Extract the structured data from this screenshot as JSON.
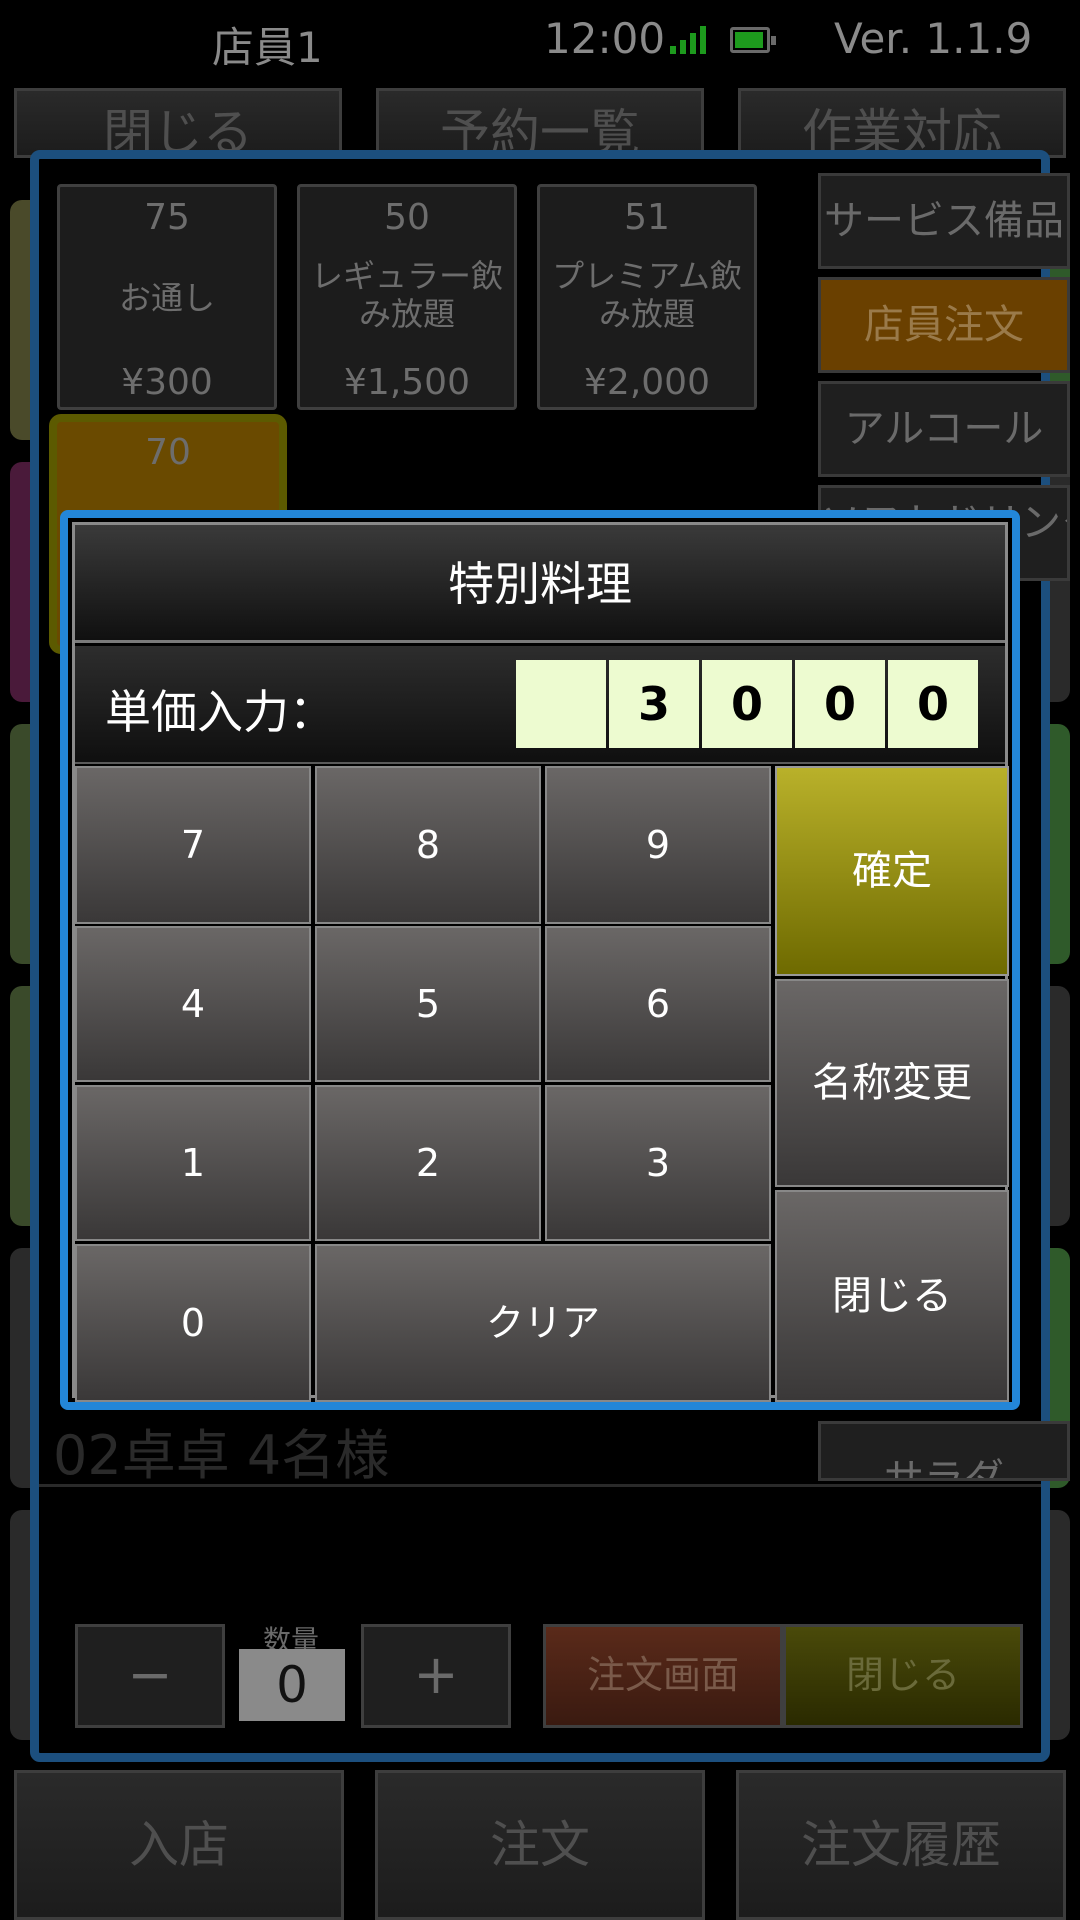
{
  "status_bar": {
    "user": "店員1",
    "time": "12:00",
    "version": "Ver. 1.1.9",
    "icons": [
      "signal-icon",
      "battery-icon"
    ],
    "colors": {
      "signal": "#1d9a1d",
      "battery": "#1d9a1d"
    }
  },
  "top_tabs": [
    "閉じる",
    "予約一覧",
    "作業対応"
  ],
  "background": {
    "table_label": "02卓卓 4名様"
  },
  "bottom_nav": [
    "入店",
    "注文",
    "注文履歴"
  ],
  "menu": {
    "items": [
      {
        "number": "75",
        "name": "お通し",
        "price": "¥300"
      },
      {
        "number": "50",
        "name": "レギュラー飲み放題",
        "price": "¥1,500"
      },
      {
        "number": "51",
        "name": "プレミアム飲み放題",
        "price": "¥2,000"
      },
      {
        "number": "70",
        "name": "",
        "price": ""
      }
    ],
    "categories": [
      "サービス備品",
      "店員注文",
      "アルコール",
      "ソフトドリンク",
      "サラダ"
    ]
  },
  "order_controls": {
    "quantity_label": "数量",
    "quantity": "0",
    "minus": "−",
    "plus": "+",
    "order_screen": "注文画面",
    "close": "閉じる"
  },
  "modal": {
    "title": "特別料理",
    "price_label": "単価入力：",
    "digits": [
      "",
      "3",
      "0",
      "0",
      "0"
    ],
    "keys": [
      "7",
      "8",
      "9",
      "4",
      "5",
      "6",
      "1",
      "2",
      "3",
      "0",
      "クリア"
    ],
    "confirm": "確定",
    "rename": "名称変更",
    "close": "閉じる",
    "colors": {
      "accent_border": "#2386d8",
      "confirm": "#b9b12a",
      "digit_bg": "#edfbd0"
    }
  }
}
